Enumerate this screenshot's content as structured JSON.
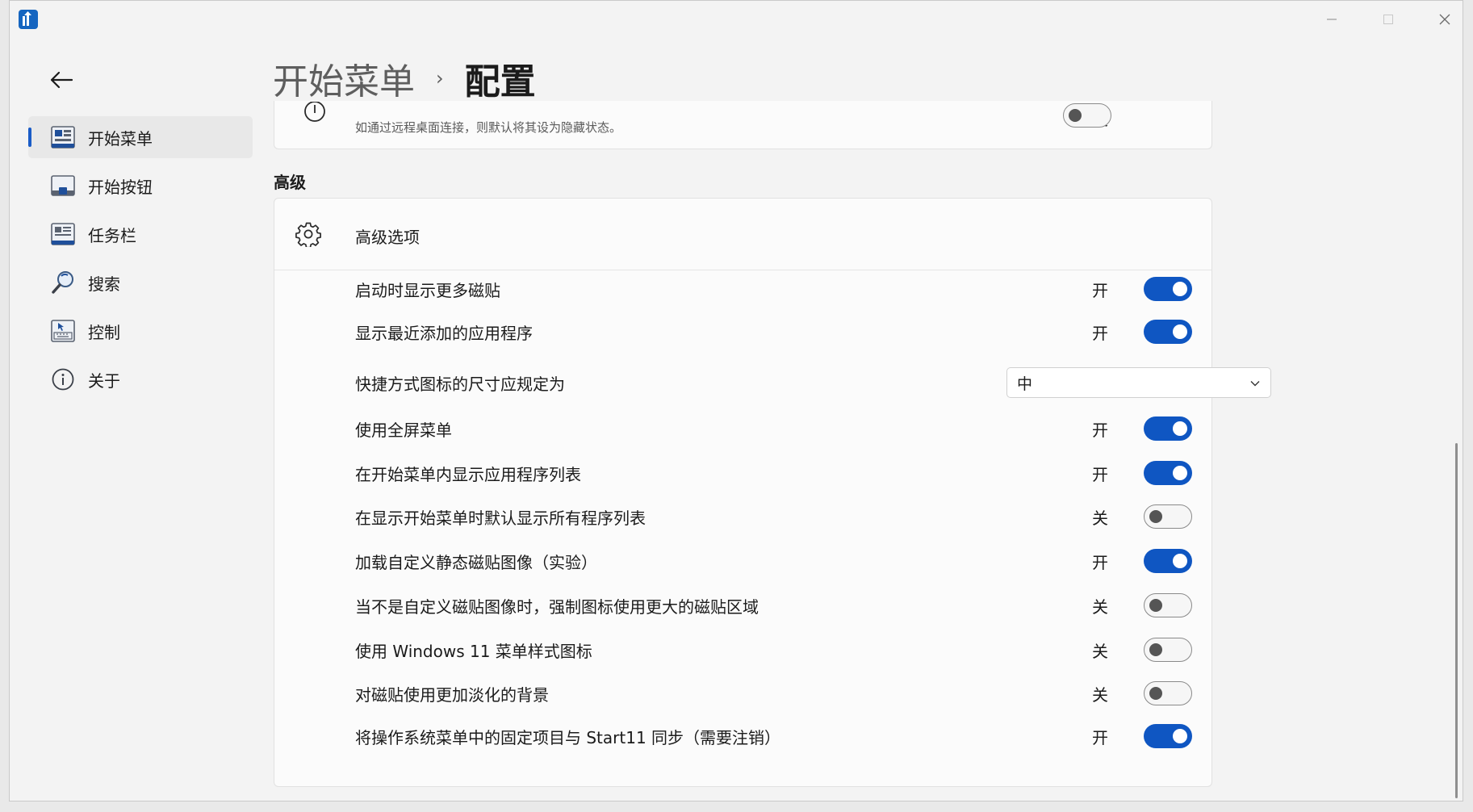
{
  "header": {
    "root": "开始菜单",
    "separator": "›",
    "current": "配置"
  },
  "nav": {
    "items": [
      {
        "label": "开始菜单",
        "icon": "start-menu-icon",
        "selected": true
      },
      {
        "label": "开始按钮",
        "icon": "start-button-icon",
        "selected": false
      },
      {
        "label": "任务栏",
        "icon": "taskbar-icon",
        "selected": false
      },
      {
        "label": "搜索",
        "icon": "search-icon",
        "selected": false
      },
      {
        "label": "控制",
        "icon": "control-icon",
        "selected": false
      },
      {
        "label": "关于",
        "icon": "info-icon",
        "selected": false
      }
    ]
  },
  "top_item": {
    "subtitle": "如通过远程桌面连接，则默认将其设为隐藏状态。",
    "state": "关",
    "on": false
  },
  "section": {
    "heading": "高级"
  },
  "advanced": {
    "title": "高级选项",
    "settings": [
      {
        "label": "启动时显示更多磁贴",
        "state": "开",
        "on": true
      },
      {
        "label": "显示最近添加的应用程序",
        "state": "开",
        "on": true
      },
      {
        "label": "快捷方式图标的尺寸应规定为",
        "value": "中"
      },
      {
        "label": "使用全屏菜单",
        "state": "开",
        "on": true
      },
      {
        "label": "在开始菜单内显示应用程序列表",
        "state": "开",
        "on": true
      },
      {
        "label": "在显示开始菜单时默认显示所有程序列表",
        "state": "关",
        "on": false
      },
      {
        "label": "加载自定义静态磁贴图像（实验）",
        "state": "开",
        "on": true
      },
      {
        "label": "当不是自定义磁贴图像时，强制图标使用更大的磁贴区域",
        "state": "关",
        "on": false
      },
      {
        "label": "使用 Windows 11 菜单样式图标",
        "state": "关",
        "on": false
      },
      {
        "label": "对磁贴使用更加淡化的背景",
        "state": "关",
        "on": false
      },
      {
        "label": "将操作系统菜单中的固定项目与 Start11 同步（需要注销）",
        "state": "开",
        "on": true
      }
    ]
  },
  "colors": {
    "accent": "#0f56c2",
    "selection_indicator": "#1a5cc7"
  }
}
